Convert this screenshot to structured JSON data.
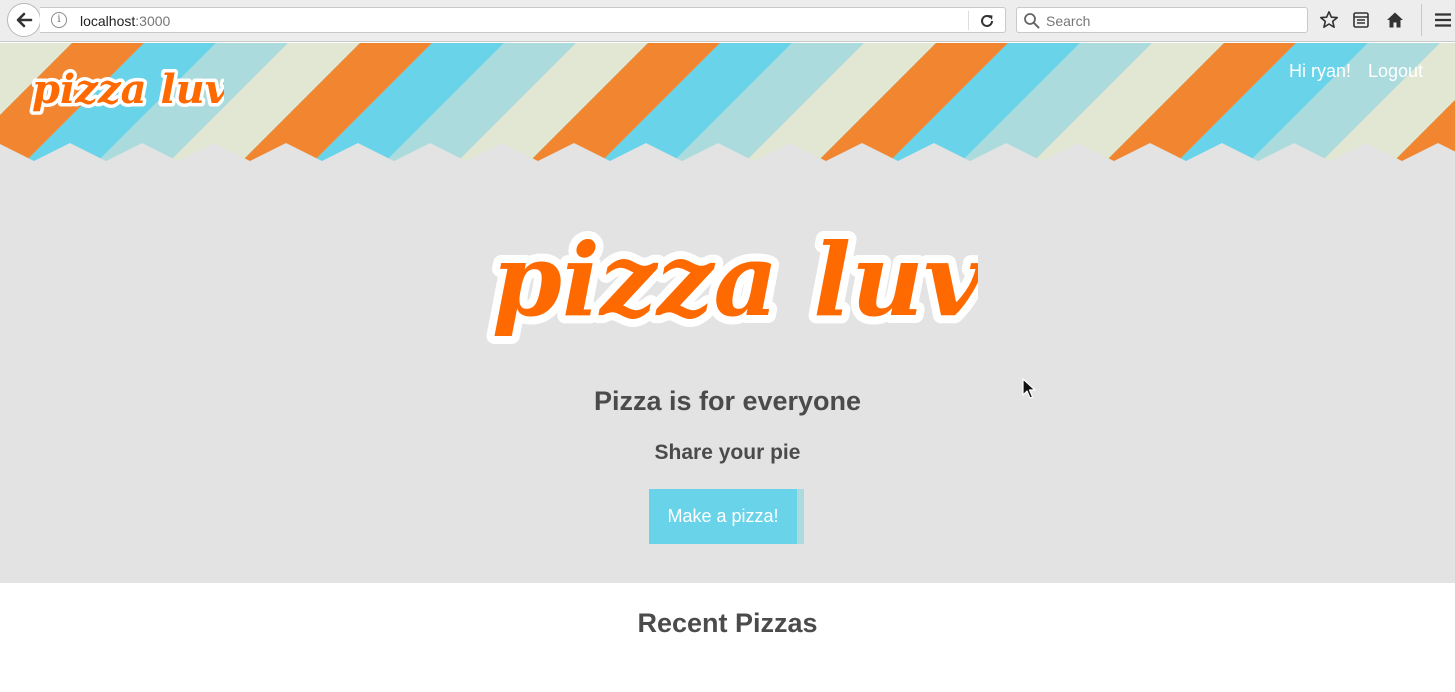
{
  "browser": {
    "url_host": "localhost",
    "url_port": ":3000",
    "search_placeholder": "Search"
  },
  "header": {
    "logo_text": "pizza luvrs",
    "greeting": "Hi ryan!",
    "logout_label": "Logout"
  },
  "hero": {
    "logo_text": "pizza luvrs",
    "tagline": "Pizza is for everyone",
    "subtagline": "Share your pie",
    "cta_label": "Make a pizza!"
  },
  "recent": {
    "title": "Recent Pizzas"
  },
  "colors": {
    "orange": "#f28530",
    "blue": "#69d3e9",
    "teal": "#acdbde",
    "cream": "#e2e7d3",
    "hero_bg": "#e3e3e3",
    "logo_orange": "#ff6a00"
  }
}
